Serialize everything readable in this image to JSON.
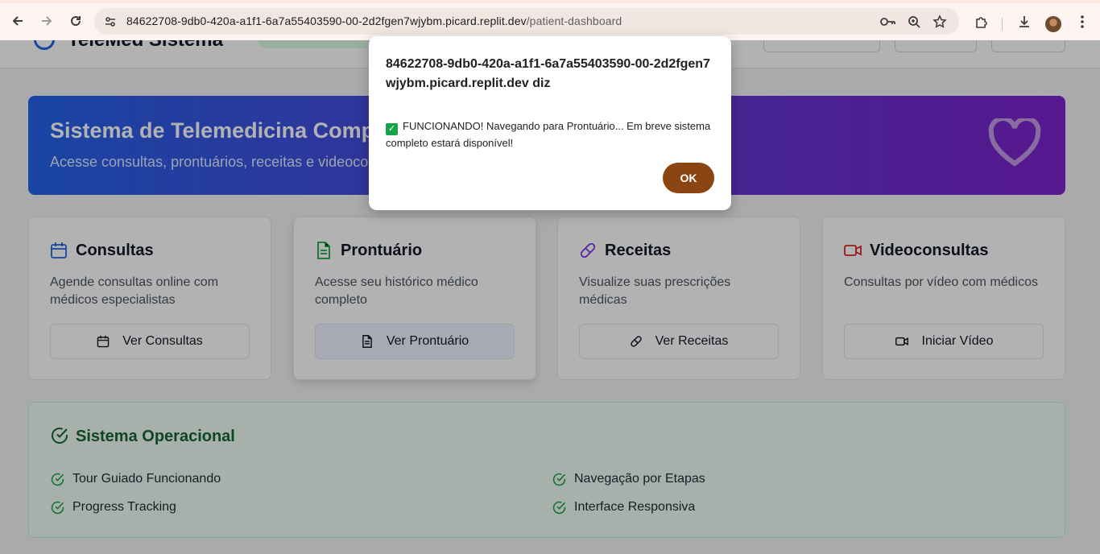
{
  "browser": {
    "url_host": "84622708-9db0-420a-a1f1-6a7a55403590-00-2d2fgen7wjybm.picard.replit.dev",
    "url_path": "/patient-dashboard",
    "icons": [
      "back-icon",
      "forward-icon",
      "reload-icon",
      "site-info-icon",
      "password-key-icon",
      "zoom-icon",
      "bookmark-star-icon",
      "extensions-icon",
      "download-icon",
      "profile-avatar",
      "menu-icon"
    ]
  },
  "header": {
    "app_title": "TeleMed Sistema"
  },
  "banner": {
    "title": "Sistema de Telemedicina Completo",
    "subtitle": "Acesse consultas, prontuários, receitas e videoconsultas"
  },
  "cards": [
    {
      "title": "Consultas",
      "description": "Agende consultas online com médicos especialistas",
      "button": "Ver Consultas",
      "icon": "calendar-icon",
      "color": "#2563eb"
    },
    {
      "title": "Prontuário",
      "description": "Acesse seu histórico médico completo",
      "button": "Ver Prontuário",
      "icon": "file-text-icon",
      "color": "#16a34a"
    },
    {
      "title": "Receitas",
      "description": "Visualize suas prescrições médicas",
      "button": "Ver Receitas",
      "icon": "pill-icon",
      "color": "#7c3aed"
    },
    {
      "title": "Videoconsultas",
      "description": "Consultas por vídeo com médicos",
      "button": "Iniciar Vídeo",
      "icon": "video-icon",
      "color": "#dc2626"
    }
  ],
  "status": {
    "title": "Sistema Operacional",
    "items": [
      "Tour Guiado Funcionando",
      "Progress Tracking",
      "Navegação por Etapas",
      "Interface Responsiva"
    ]
  },
  "dialog": {
    "title": "84622708-9db0-420a-a1f1-6a7a55403590-00-2d2fgen7wjybm.picard.replit.dev diz",
    "message": "FUNCIONANDO! Navegando para Prontuário... Em breve sistema completo estará disponível!",
    "ok_label": "OK"
  }
}
